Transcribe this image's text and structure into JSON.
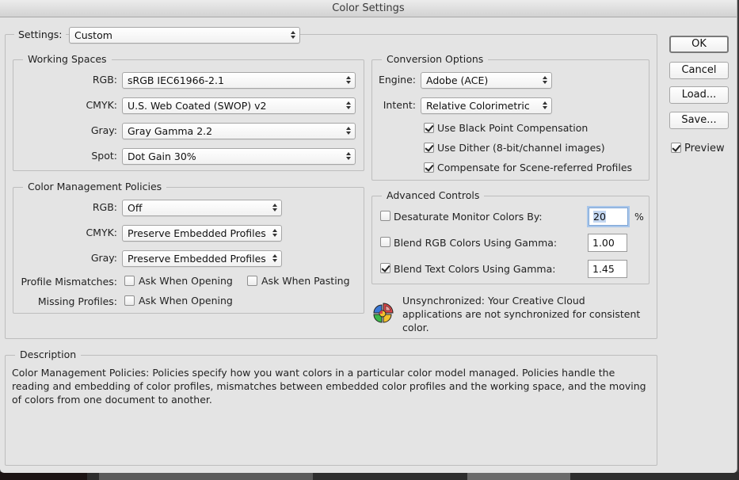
{
  "window": {
    "title": "Color Settings"
  },
  "settings": {
    "label": "Settings:",
    "value": "Custom"
  },
  "working_spaces": {
    "title": "Working Spaces",
    "rows": [
      {
        "label": "RGB:",
        "value": "sRGB IEC61966-2.1"
      },
      {
        "label": "CMYK:",
        "value": "U.S. Web Coated (SWOP) v2"
      },
      {
        "label": "Gray:",
        "value": "Gray Gamma 2.2"
      },
      {
        "label": "Spot:",
        "value": "Dot Gain 30%"
      }
    ]
  },
  "policies": {
    "title": "Color Management Policies",
    "rows": [
      {
        "label": "RGB:",
        "value": "Off"
      },
      {
        "label": "CMYK:",
        "value": "Preserve Embedded Profiles"
      },
      {
        "label": "Gray:",
        "value": "Preserve Embedded Profiles"
      }
    ],
    "profile_mismatches": {
      "label": "Profile Mismatches:",
      "ask_opening": {
        "label": "Ask When Opening",
        "checked": false
      },
      "ask_pasting": {
        "label": "Ask When Pasting",
        "checked": false
      }
    },
    "missing_profiles": {
      "label": "Missing Profiles:",
      "ask_opening": {
        "label": "Ask When Opening",
        "checked": false
      }
    }
  },
  "conversion": {
    "title": "Conversion Options",
    "engine": {
      "label": "Engine:",
      "value": "Adobe (ACE)"
    },
    "intent": {
      "label": "Intent:",
      "value": "Relative Colorimetric"
    },
    "options": [
      {
        "label": "Use Black Point Compensation",
        "checked": true
      },
      {
        "label": "Use Dither (8-bit/channel images)",
        "checked": true
      },
      {
        "label": "Compensate for Scene-referred Profiles",
        "checked": true
      }
    ]
  },
  "advanced": {
    "title": "Advanced Controls",
    "desaturate": {
      "label": "Desaturate Monitor Colors By:",
      "checked": false,
      "value": "20",
      "unit": "%"
    },
    "blend_rgb": {
      "label": "Blend RGB Colors Using Gamma:",
      "checked": false,
      "value": "1.00"
    },
    "blend_text": {
      "label": "Blend Text Colors Using Gamma:",
      "checked": true,
      "value": "1.45"
    }
  },
  "sync": {
    "line1": "Unsynchronized: Your Creative Cloud",
    "line2": "applications are not synchronized for consistent",
    "line3": "color.",
    "icon": "color-sync-icon"
  },
  "buttons": {
    "ok": "OK",
    "cancel": "Cancel",
    "load": "Load...",
    "save": "Save..."
  },
  "preview": {
    "label": "Preview",
    "checked": true
  },
  "description": {
    "title": "Description",
    "line1": "Color Management Policies:  Policies specify how you want colors in a particular color model managed.  Policies handle the",
    "line2": "reading and embedding of color profiles, mismatches between embedded color profiles and the working space, and the moving",
    "line3": "of colors from one document to another."
  }
}
